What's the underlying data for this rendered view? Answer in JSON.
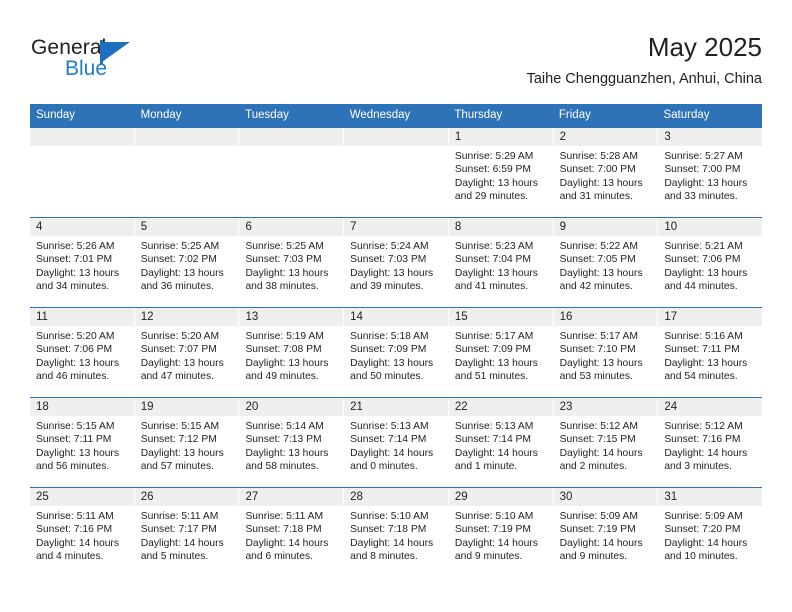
{
  "brand": {
    "name_top": "General",
    "name_bottom": "Blue",
    "flag_icon": "triangle-flag-icon",
    "accent_color": "#1f7ec4"
  },
  "header": {
    "title": "May 2025",
    "subtitle": "Taihe Chengguanzhen, Anhui, China"
  },
  "theme": {
    "header_blue": "#2e72b8",
    "date_strip_gray": "#efefef",
    "text": "#231f20"
  },
  "calendar": {
    "weekday_headers": [
      "Sunday",
      "Monday",
      "Tuesday",
      "Wednesday",
      "Thursday",
      "Friday",
      "Saturday"
    ],
    "weeks": [
      [
        {
          "day": "",
          "sunrise": "",
          "sunset": "",
          "daylight": ""
        },
        {
          "day": "",
          "sunrise": "",
          "sunset": "",
          "daylight": ""
        },
        {
          "day": "",
          "sunrise": "",
          "sunset": "",
          "daylight": ""
        },
        {
          "day": "",
          "sunrise": "",
          "sunset": "",
          "daylight": ""
        },
        {
          "day": "1",
          "sunrise": "Sunrise: 5:29 AM",
          "sunset": "Sunset: 6:59 PM",
          "daylight": "Daylight: 13 hours and 29 minutes."
        },
        {
          "day": "2",
          "sunrise": "Sunrise: 5:28 AM",
          "sunset": "Sunset: 7:00 PM",
          "daylight": "Daylight: 13 hours and 31 minutes."
        },
        {
          "day": "3",
          "sunrise": "Sunrise: 5:27 AM",
          "sunset": "Sunset: 7:00 PM",
          "daylight": "Daylight: 13 hours and 33 minutes."
        }
      ],
      [
        {
          "day": "4",
          "sunrise": "Sunrise: 5:26 AM",
          "sunset": "Sunset: 7:01 PM",
          "daylight": "Daylight: 13 hours and 34 minutes."
        },
        {
          "day": "5",
          "sunrise": "Sunrise: 5:25 AM",
          "sunset": "Sunset: 7:02 PM",
          "daylight": "Daylight: 13 hours and 36 minutes."
        },
        {
          "day": "6",
          "sunrise": "Sunrise: 5:25 AM",
          "sunset": "Sunset: 7:03 PM",
          "daylight": "Daylight: 13 hours and 38 minutes."
        },
        {
          "day": "7",
          "sunrise": "Sunrise: 5:24 AM",
          "sunset": "Sunset: 7:03 PM",
          "daylight": "Daylight: 13 hours and 39 minutes."
        },
        {
          "day": "8",
          "sunrise": "Sunrise: 5:23 AM",
          "sunset": "Sunset: 7:04 PM",
          "daylight": "Daylight: 13 hours and 41 minutes."
        },
        {
          "day": "9",
          "sunrise": "Sunrise: 5:22 AM",
          "sunset": "Sunset: 7:05 PM",
          "daylight": "Daylight: 13 hours and 42 minutes."
        },
        {
          "day": "10",
          "sunrise": "Sunrise: 5:21 AM",
          "sunset": "Sunset: 7:06 PM",
          "daylight": "Daylight: 13 hours and 44 minutes."
        }
      ],
      [
        {
          "day": "11",
          "sunrise": "Sunrise: 5:20 AM",
          "sunset": "Sunset: 7:06 PM",
          "daylight": "Daylight: 13 hours and 46 minutes."
        },
        {
          "day": "12",
          "sunrise": "Sunrise: 5:20 AM",
          "sunset": "Sunset: 7:07 PM",
          "daylight": "Daylight: 13 hours and 47 minutes."
        },
        {
          "day": "13",
          "sunrise": "Sunrise: 5:19 AM",
          "sunset": "Sunset: 7:08 PM",
          "daylight": "Daylight: 13 hours and 49 minutes."
        },
        {
          "day": "14",
          "sunrise": "Sunrise: 5:18 AM",
          "sunset": "Sunset: 7:09 PM",
          "daylight": "Daylight: 13 hours and 50 minutes."
        },
        {
          "day": "15",
          "sunrise": "Sunrise: 5:17 AM",
          "sunset": "Sunset: 7:09 PM",
          "daylight": "Daylight: 13 hours and 51 minutes."
        },
        {
          "day": "16",
          "sunrise": "Sunrise: 5:17 AM",
          "sunset": "Sunset: 7:10 PM",
          "daylight": "Daylight: 13 hours and 53 minutes."
        },
        {
          "day": "17",
          "sunrise": "Sunrise: 5:16 AM",
          "sunset": "Sunset: 7:11 PM",
          "daylight": "Daylight: 13 hours and 54 minutes."
        }
      ],
      [
        {
          "day": "18",
          "sunrise": "Sunrise: 5:15 AM",
          "sunset": "Sunset: 7:11 PM",
          "daylight": "Daylight: 13 hours and 56 minutes."
        },
        {
          "day": "19",
          "sunrise": "Sunrise: 5:15 AM",
          "sunset": "Sunset: 7:12 PM",
          "daylight": "Daylight: 13 hours and 57 minutes."
        },
        {
          "day": "20",
          "sunrise": "Sunrise: 5:14 AM",
          "sunset": "Sunset: 7:13 PM",
          "daylight": "Daylight: 13 hours and 58 minutes."
        },
        {
          "day": "21",
          "sunrise": "Sunrise: 5:13 AM",
          "sunset": "Sunset: 7:14 PM",
          "daylight": "Daylight: 14 hours and 0 minutes."
        },
        {
          "day": "22",
          "sunrise": "Sunrise: 5:13 AM",
          "sunset": "Sunset: 7:14 PM",
          "daylight": "Daylight: 14 hours and 1 minute."
        },
        {
          "day": "23",
          "sunrise": "Sunrise: 5:12 AM",
          "sunset": "Sunset: 7:15 PM",
          "daylight": "Daylight: 14 hours and 2 minutes."
        },
        {
          "day": "24",
          "sunrise": "Sunrise: 5:12 AM",
          "sunset": "Sunset: 7:16 PM",
          "daylight": "Daylight: 14 hours and 3 minutes."
        }
      ],
      [
        {
          "day": "25",
          "sunrise": "Sunrise: 5:11 AM",
          "sunset": "Sunset: 7:16 PM",
          "daylight": "Daylight: 14 hours and 4 minutes."
        },
        {
          "day": "26",
          "sunrise": "Sunrise: 5:11 AM",
          "sunset": "Sunset: 7:17 PM",
          "daylight": "Daylight: 14 hours and 5 minutes."
        },
        {
          "day": "27",
          "sunrise": "Sunrise: 5:11 AM",
          "sunset": "Sunset: 7:18 PM",
          "daylight": "Daylight: 14 hours and 6 minutes."
        },
        {
          "day": "28",
          "sunrise": "Sunrise: 5:10 AM",
          "sunset": "Sunset: 7:18 PM",
          "daylight": "Daylight: 14 hours and 8 minutes."
        },
        {
          "day": "29",
          "sunrise": "Sunrise: 5:10 AM",
          "sunset": "Sunset: 7:19 PM",
          "daylight": "Daylight: 14 hours and 9 minutes."
        },
        {
          "day": "30",
          "sunrise": "Sunrise: 5:09 AM",
          "sunset": "Sunset: 7:19 PM",
          "daylight": "Daylight: 14 hours and 9 minutes."
        },
        {
          "day": "31",
          "sunrise": "Sunrise: 5:09 AM",
          "sunset": "Sunset: 7:20 PM",
          "daylight": "Daylight: 14 hours and 10 minutes."
        }
      ]
    ]
  }
}
